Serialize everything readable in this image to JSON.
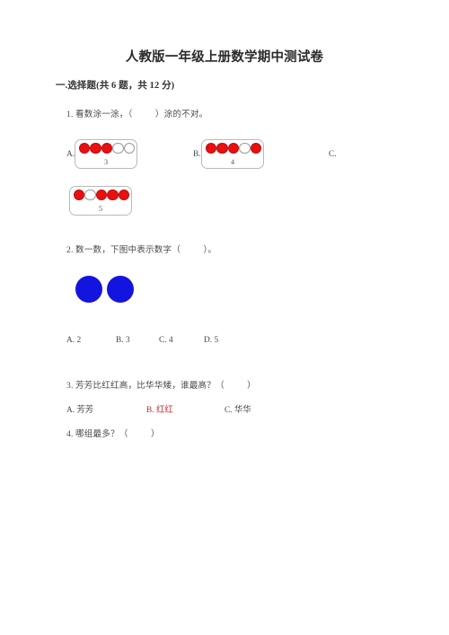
{
  "document": {
    "title": "人教版一年级上册数学期中测试卷",
    "section_heading": "一.选择题(共 6 题，共 12 分)"
  },
  "questions": [
    {
      "stem": "1. 看数涂一涂，（          ）涂的不对。",
      "options": [
        {
          "label": "A.",
          "number": "3",
          "beads": [
            "red",
            "red",
            "red",
            "white",
            "white"
          ]
        },
        {
          "label": "B.",
          "number": "4",
          "beads": [
            "red",
            "red",
            "red",
            "white",
            "red"
          ]
        },
        {
          "label": "C.",
          "number": "5",
          "beads": [
            "red",
            "white",
            "red",
            "red",
            "red"
          ]
        }
      ]
    },
    {
      "stem": "2. 数一数，下图中表示数字（          ）。",
      "figure": {
        "name": "two-blue-circles",
        "shape": "circle",
        "color": "#1414e0",
        "count": 2
      },
      "choices": [
        {
          "label": "A.",
          "value": "2"
        },
        {
          "label": "B.",
          "value": "3"
        },
        {
          "label": "C.",
          "value": "4"
        },
        {
          "label": "D.",
          "value": "5"
        }
      ]
    },
    {
      "stem": "3. 芳芳比红红高，比华华矮，谁最高？（          ）",
      "choices": [
        {
          "label": "A.",
          "value": "芳芳",
          "color": "#4a4a4a"
        },
        {
          "label": "B.",
          "value": "红红",
          "color": "#d02a2a"
        },
        {
          "label": "C.",
          "value": "华华",
          "color": "#4a4a4a"
        }
      ]
    },
    {
      "stem": "4. 哪组最多？（          ）"
    }
  ],
  "choice_text": {
    "q2_a": "A. 2",
    "q2_b": "B. 3",
    "q2_c": "C. 4",
    "q2_d": "D. 5",
    "q3_a": "A. 芳芳",
    "q3_b": "B. 红红",
    "q3_c": "C. 华华"
  },
  "colors": {
    "bead_red": "#e81010",
    "bead_white": "#ffffff",
    "dot_blue": "#1414e0",
    "answer_red": "#d02a2a",
    "box_border": "#b9b9b9"
  }
}
